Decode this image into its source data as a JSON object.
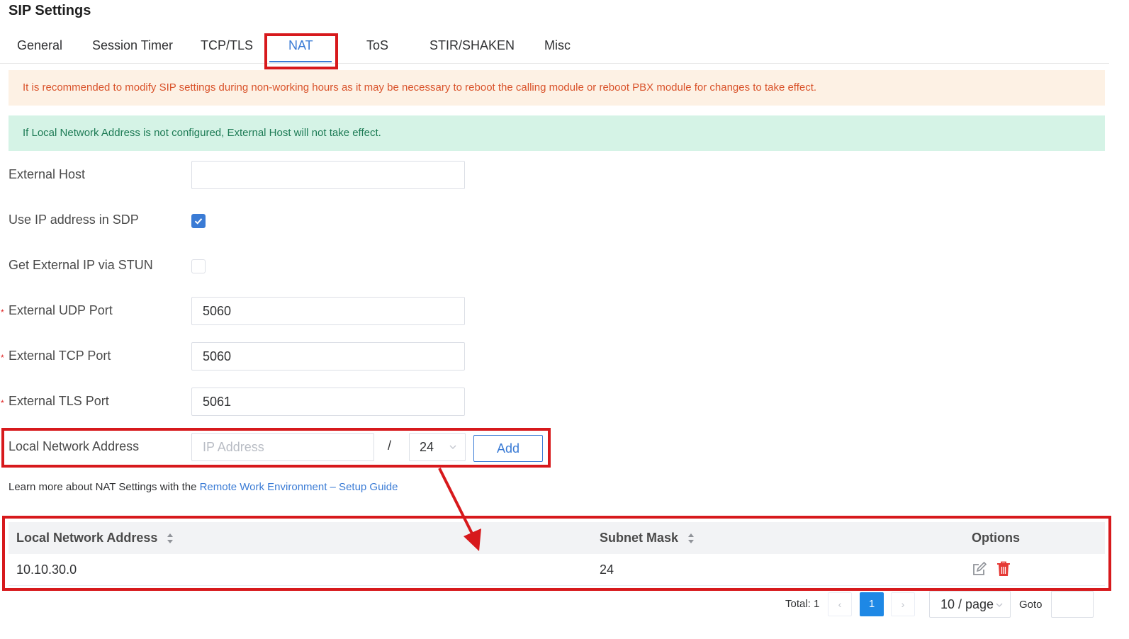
{
  "page": {
    "title": "SIP Settings"
  },
  "tabs": [
    {
      "label": "General"
    },
    {
      "label": "Session Timer"
    },
    {
      "label": "TCP/TLS"
    },
    {
      "label": "NAT",
      "active": true
    },
    {
      "label": "ToS"
    },
    {
      "label": "STIR/SHAKEN"
    },
    {
      "label": "Misc"
    }
  ],
  "alerts": {
    "warning": "It is recommended to modify SIP settings during non-working hours as it may be necessary to reboot the calling module or reboot PBX module for changes to take effect.",
    "info": "If Local Network Address is not configured, External Host will not take effect."
  },
  "form": {
    "external_host": {
      "label": "External Host",
      "value": ""
    },
    "use_ip_in_sdp": {
      "label": "Use IP address in SDP",
      "checked": true
    },
    "stun": {
      "label": "Get External IP via STUN",
      "checked": false
    },
    "udp_port": {
      "label": "External UDP Port",
      "value": "5060",
      "required_mark": "*"
    },
    "tcp_port": {
      "label": "External TCP Port",
      "value": "5060",
      "required_mark": "*"
    },
    "tls_port": {
      "label": "External TLS Port",
      "value": "5061",
      "required_mark": "*"
    },
    "local_network": {
      "label": "Local Network Address",
      "ip_placeholder": "IP Address",
      "separator": "/",
      "mask_value": "24",
      "add_label": "Add"
    }
  },
  "learn_more": {
    "prefix": "Learn more about NAT Settings with the ",
    "link_text": "Remote Work Environment – Setup Guide"
  },
  "table": {
    "headers": {
      "address": "Local Network Address",
      "mask": "Subnet Mask",
      "options": "Options"
    },
    "rows": [
      {
        "address": "10.10.30.0",
        "mask": "24"
      }
    ]
  },
  "pagination": {
    "total": "Total: 1",
    "prev": "‹",
    "current_page": "1",
    "next": "›",
    "page_size": "10 / page",
    "goto_label": "Goto"
  },
  "colors": {
    "accent": "#3a7bd5",
    "highlight": "#d7191c",
    "warning_bg": "#fdf1e4",
    "info_bg": "#d5f3e6"
  }
}
